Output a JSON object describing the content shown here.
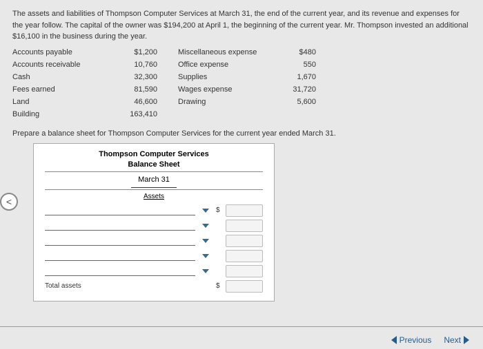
{
  "intro": "The assets and liabilities of Thompson Computer Services at March 31, the end of the current year, and its revenue and expenses for the year follow. The capital of the owner was $194,200 at April 1, the beginning of the current year. Mr. Thompson invested an additional $16,100 in the business during the year.",
  "accounts": {
    "left": [
      {
        "label": "Accounts payable",
        "value": "$1,200"
      },
      {
        "label": "Accounts receivable",
        "value": "10,760"
      },
      {
        "label": "Cash",
        "value": "32,300"
      },
      {
        "label": "Fees earned",
        "value": "81,590"
      },
      {
        "label": "Land",
        "value": "46,600"
      },
      {
        "label": "Building",
        "value": "163,410"
      }
    ],
    "right": [
      {
        "label": "Miscellaneous expense",
        "value": "$480"
      },
      {
        "label": "Office expense",
        "value": "550"
      },
      {
        "label": "Supplies",
        "value": "1,670"
      },
      {
        "label": "Wages expense",
        "value": "31,720"
      },
      {
        "label": "Drawing",
        "value": "5,600"
      },
      {
        "label": "",
        "value": ""
      }
    ]
  },
  "instruction": "Prepare a balance sheet for Thompson Computer Services for the current year ended March 31.",
  "sheet": {
    "company": "Thompson Computer Services",
    "title": "Balance Sheet",
    "date": "March 31",
    "section": "Assets",
    "total": "Total assets"
  },
  "nav": {
    "back_circle": "<",
    "previous": "Previous",
    "next": "Next"
  }
}
